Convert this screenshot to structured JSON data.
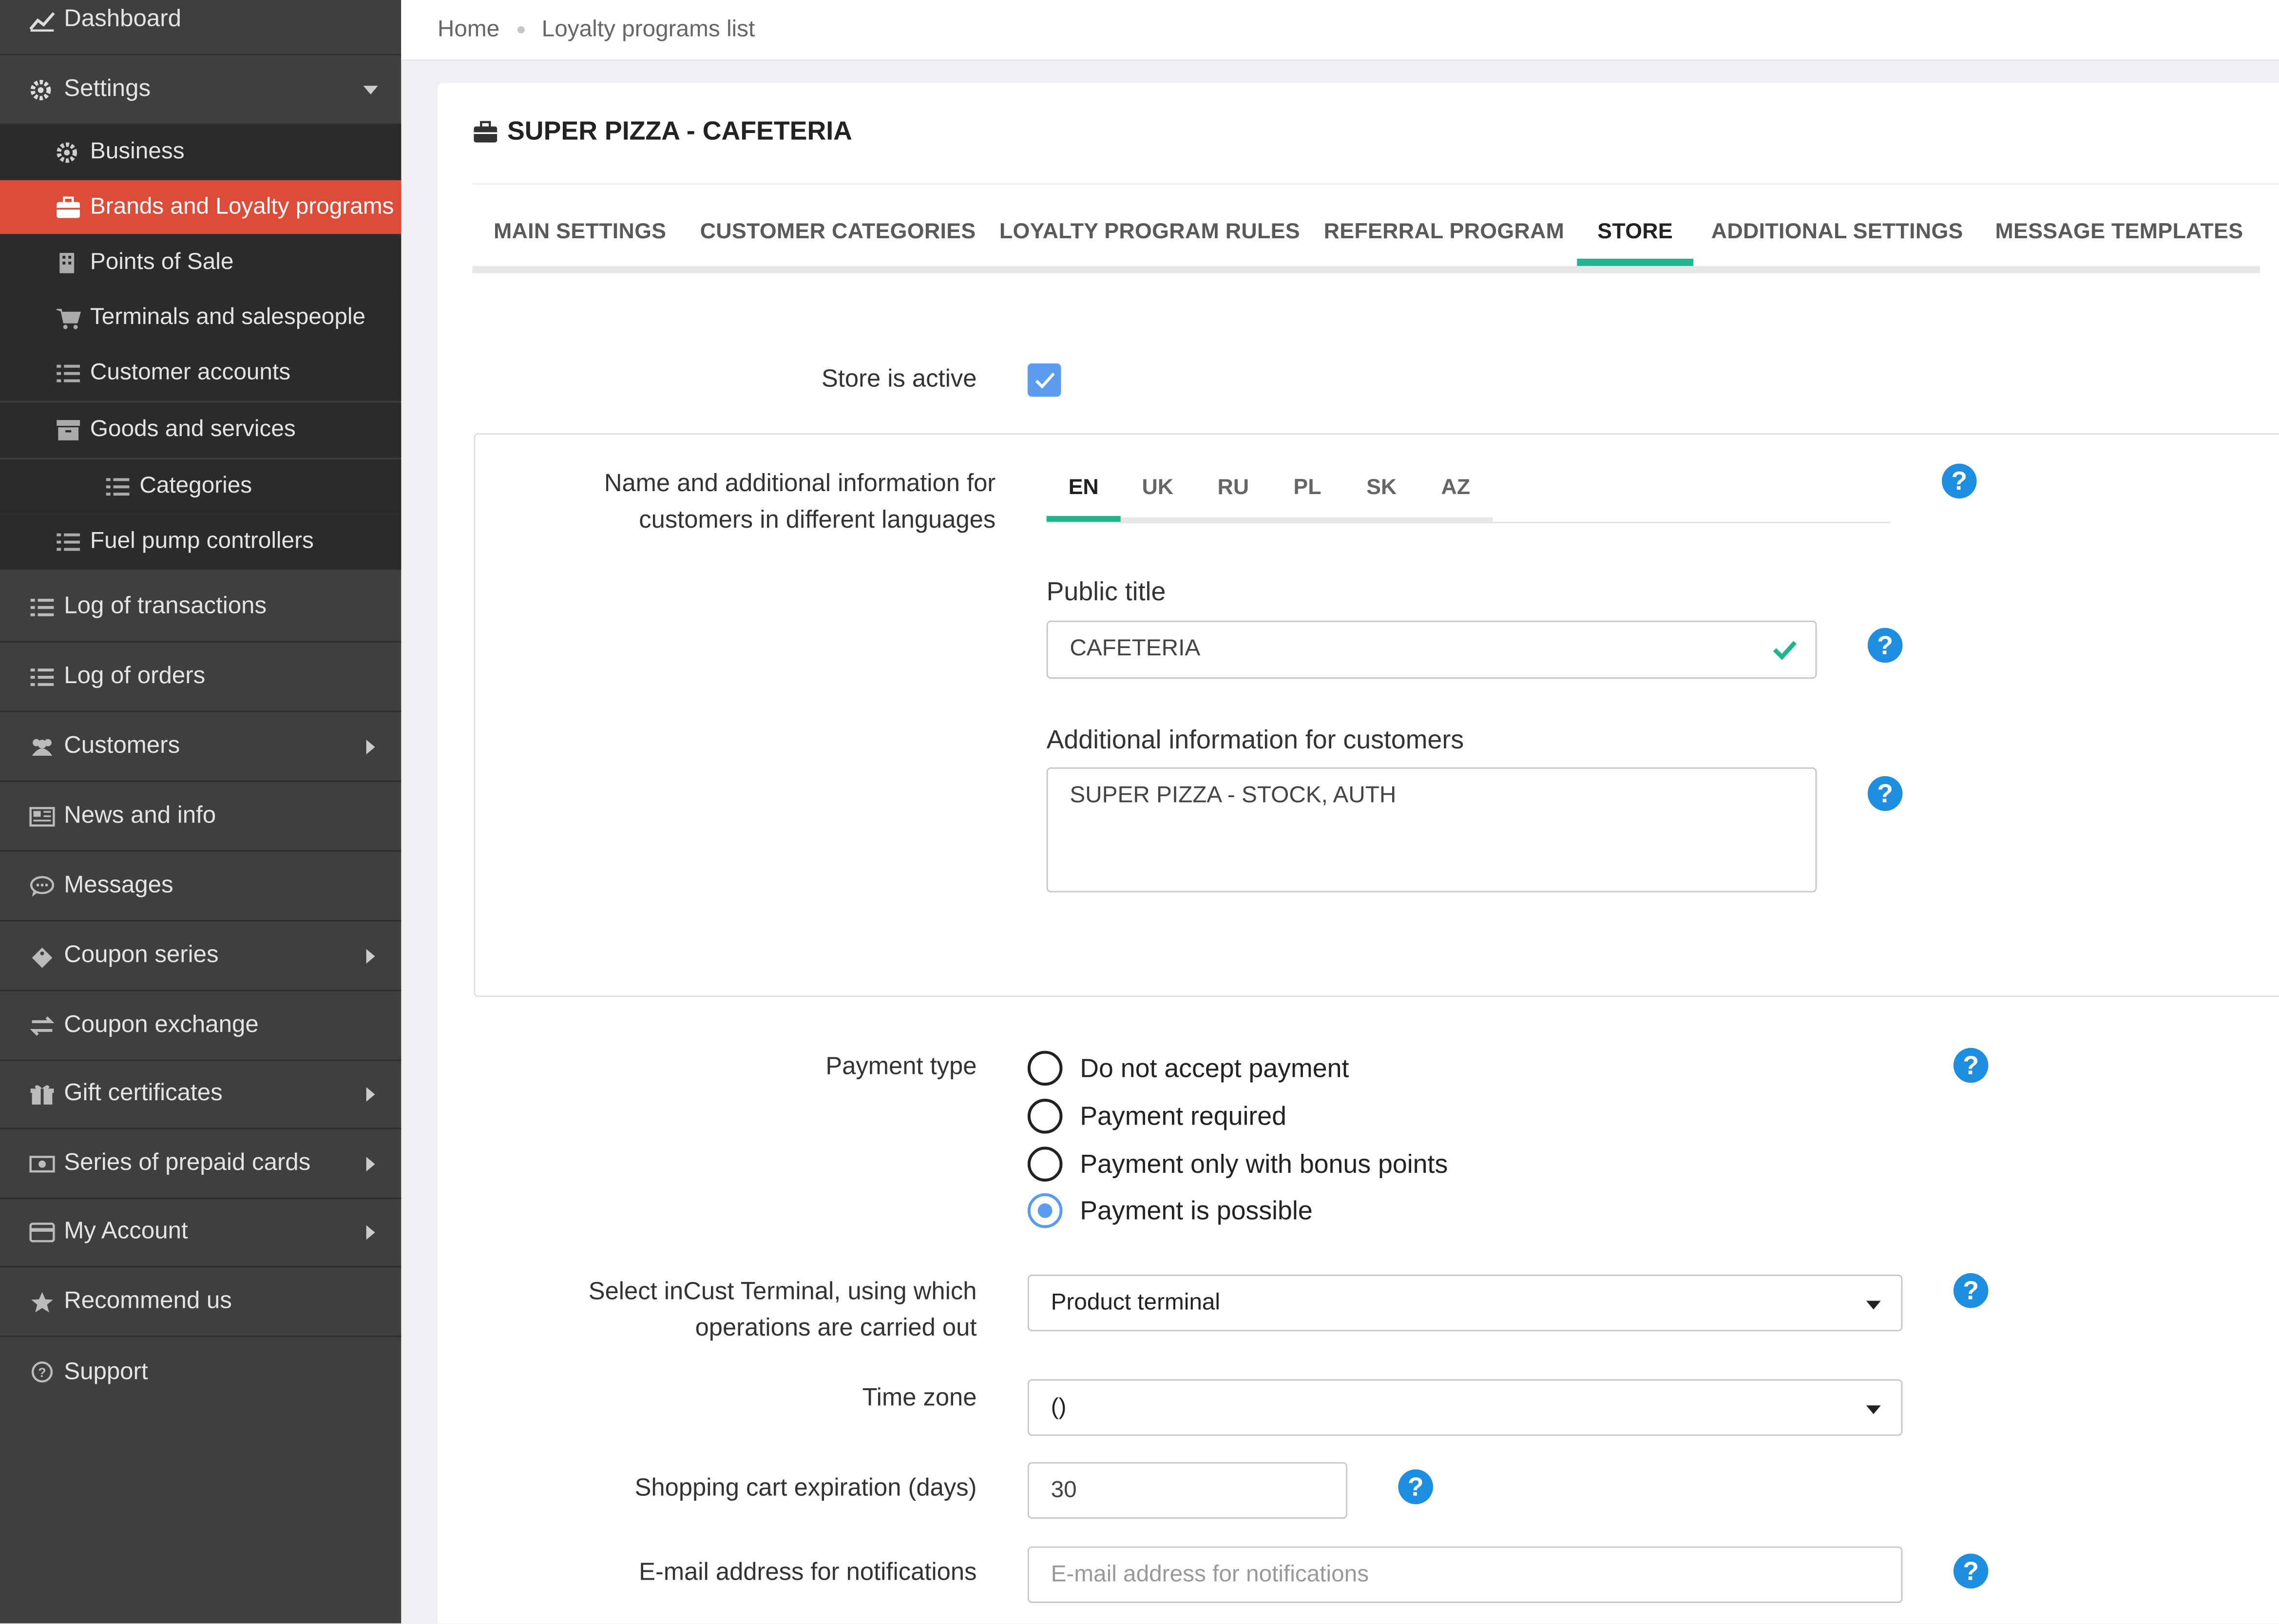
{
  "sidebar": {
    "items": [
      {
        "label": "Dashboard",
        "icon": "chart-icon"
      },
      {
        "label": "Settings",
        "icon": "gear-icon"
      },
      {
        "label": "Business",
        "icon": "gear-icon"
      },
      {
        "label": "Brands and Loyalty programs",
        "icon": "briefcase-icon"
      },
      {
        "label": "Points of Sale",
        "icon": "building-icon"
      },
      {
        "label": "Terminals and salespeople",
        "icon": "cart-icon"
      },
      {
        "label": "Customer accounts",
        "icon": "list-icon"
      },
      {
        "label": "Goods and services",
        "icon": "archive-icon"
      },
      {
        "label": "Categories",
        "icon": "list-icon"
      },
      {
        "label": "Fuel pump controllers",
        "icon": "list-icon"
      },
      {
        "label": "Log of transactions",
        "icon": "list-icon"
      },
      {
        "label": "Log of orders",
        "icon": "list-icon"
      },
      {
        "label": "Customers",
        "icon": "users-icon"
      },
      {
        "label": "News and info",
        "icon": "newspaper-icon"
      },
      {
        "label": "Messages",
        "icon": "chat-icon"
      },
      {
        "label": "Coupon series",
        "icon": "ticket-icon"
      },
      {
        "label": "Coupon exchange",
        "icon": "exchange-icon"
      },
      {
        "label": "Gift certificates",
        "icon": "gift-icon"
      },
      {
        "label": "Series of prepaid cards",
        "icon": "money-icon"
      },
      {
        "label": "My Account",
        "icon": "card-icon"
      },
      {
        "label": "Recommend us",
        "icon": "star-icon"
      },
      {
        "label": "Support",
        "icon": "question-circle-icon"
      }
    ]
  },
  "breadcrumb": {
    "home": "Home",
    "current": "Loyalty programs list"
  },
  "store": {
    "title": "SUPER PIZZA - CAFETERIA"
  },
  "tabs": [
    "MAIN SETTINGS",
    "CUSTOMER CATEGORIES",
    "LOYALTY PROGRAM RULES",
    "REFERRAL PROGRAM",
    "STORE",
    "ADDITIONAL SETTINGS",
    "MESSAGE TEMPLATES"
  ],
  "active_tab": "STORE",
  "form": {
    "store_active_label": "Store is active",
    "store_active": true,
    "lang_label_1": "Name and additional information for",
    "lang_label_2": "customers in different languages",
    "languages": [
      "EN",
      "UK",
      "RU",
      "PL",
      "SK",
      "AZ"
    ],
    "active_language": "EN",
    "public_title_label": "Public title",
    "public_title_value": "CAFETERIA",
    "additional_info_label": "Additional information for customers",
    "additional_info_value": "SUPER PIZZA - STOCK, AUTH",
    "payment_type_label": "Payment type",
    "payment_options": [
      "Do not accept payment",
      "Payment required",
      "Payment only with bonus points",
      "Payment is possible"
    ],
    "payment_selected": "Payment is possible",
    "terminal_label_1": "Select inCust Terminal, using which",
    "terminal_label_2": "operations are carried out",
    "terminal_value": "Product terminal",
    "timezone_label": "Time zone",
    "timezone_value": "()",
    "cart_expiration_label": "Shopping cart expiration (days)",
    "cart_expiration_value": "30",
    "email_label": "E-mail address for notifications",
    "email_placeholder": "E-mail address for notifications"
  },
  "colors": {
    "sidebar": "#3f3f3f",
    "active": "#dd4b39",
    "accent": "#1fb58f",
    "help": "#1d8ee0",
    "checkbox": "#5b9bf0"
  }
}
